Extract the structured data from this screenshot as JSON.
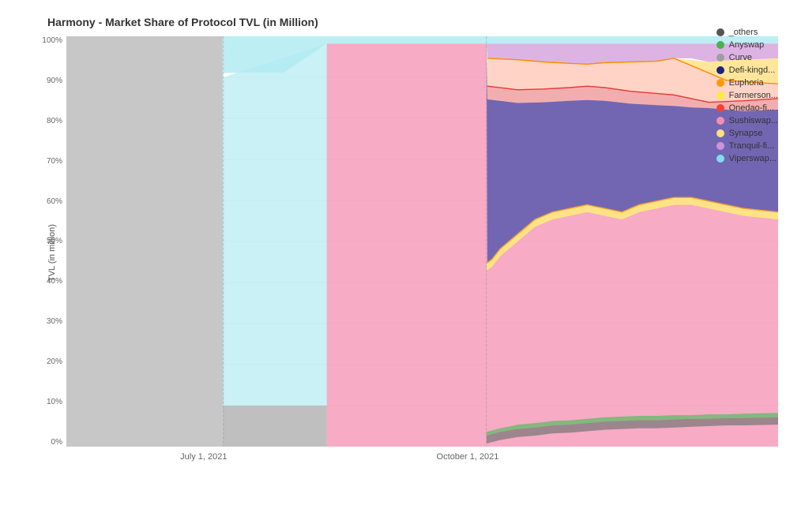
{
  "title": "Harmony - Market Share of Protocol TVL (in Million)",
  "yAxisLabel": "TVL (in million)",
  "yTicks": [
    "100%",
    "90%",
    "80%",
    "70%",
    "60%",
    "50%",
    "40%",
    "30%",
    "20%",
    "10%",
    "0%"
  ],
  "xTicks": [
    {
      "label": "July 1, 2021",
      "pct": 22
    },
    {
      "label": "October 1, 2021",
      "pct": 59
    }
  ],
  "legend": [
    {
      "label": "_others",
      "color": "#555555"
    },
    {
      "label": "Anyswap",
      "color": "#4caf50"
    },
    {
      "label": "Curve",
      "color": "#9e9e9e"
    },
    {
      "label": "Defi-kingd...",
      "color": "#1a237e"
    },
    {
      "label": "Euphoria",
      "color": "#ff9800"
    },
    {
      "label": "Farmerson...",
      "color": "#ffeb3b"
    },
    {
      "label": "Onedao-fi...",
      "color": "#f44336"
    },
    {
      "label": "Sushiswap...",
      "color": "#f48fb1"
    },
    {
      "label": "Synapse",
      "color": "#ffe082"
    },
    {
      "label": "Tranquil-fi...",
      "color": "#ce93d8"
    },
    {
      "label": "Viperswap...",
      "color": "#80deea"
    }
  ]
}
